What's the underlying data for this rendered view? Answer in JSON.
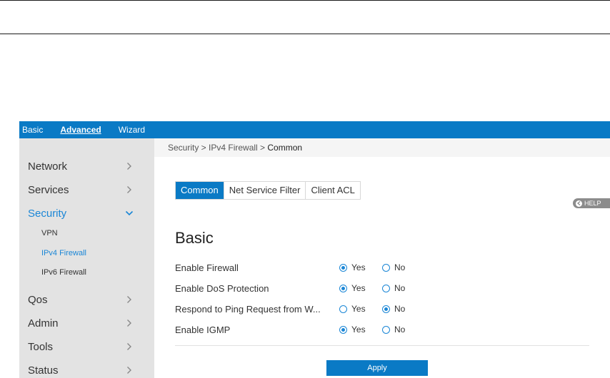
{
  "topnav": {
    "items": [
      {
        "label": "Basic",
        "active": false
      },
      {
        "label": "Advanced",
        "active": true
      },
      {
        "label": "Wizard",
        "active": false
      }
    ]
  },
  "sidebar": {
    "items": [
      {
        "label": "Network",
        "expanded": false
      },
      {
        "label": "Services",
        "expanded": false
      },
      {
        "label": "Security",
        "expanded": true,
        "active": true
      },
      {
        "label": "Qos",
        "expanded": false
      },
      {
        "label": "Admin",
        "expanded": false
      },
      {
        "label": "Tools",
        "expanded": false
      },
      {
        "label": "Status",
        "expanded": false
      }
    ],
    "security_sub": [
      {
        "label": "VPN",
        "active": false
      },
      {
        "label": "IPv4 Firewall",
        "active": true
      },
      {
        "label": "IPv6 Firewall",
        "active": false
      }
    ]
  },
  "breadcrumb": {
    "path": "Security > IPv4 Firewall > ",
    "current": "Common"
  },
  "tabs": [
    {
      "label": "Common",
      "active": true
    },
    {
      "label": "Net Service Filter",
      "active": false
    },
    {
      "label": "Client ACL",
      "active": false
    }
  ],
  "help": {
    "label": "HELP"
  },
  "section": {
    "title": "Basic"
  },
  "settings": [
    {
      "label": "Enable Firewall",
      "value": "Yes"
    },
    {
      "label": "Enable DoS Protection",
      "value": "Yes"
    },
    {
      "label": "Respond to Ping Request from W...",
      "value": "No"
    },
    {
      "label": "Enable IGMP",
      "value": "Yes"
    }
  ],
  "options": {
    "yes": "Yes",
    "no": "No"
  },
  "apply": {
    "label": "Apply"
  },
  "colors": {
    "accent": "#0a7ac5",
    "active_text": "#1a86d6",
    "sidebar_bg": "#e3e3e3"
  }
}
